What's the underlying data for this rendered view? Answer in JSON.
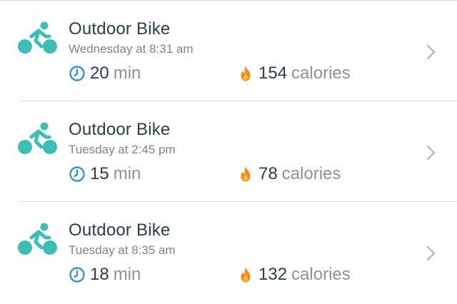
{
  "activities": [
    {
      "icon": "bike-icon",
      "title": "Outdoor Bike",
      "when": "Wednesday at 8:31 am",
      "duration_value": "20",
      "duration_unit": "min",
      "calories_value": "154",
      "calories_unit": "calories"
    },
    {
      "icon": "bike-icon",
      "title": "Outdoor Bike",
      "when": "Tuesday at 2:45 pm",
      "duration_value": "15",
      "duration_unit": "min",
      "calories_value": "78",
      "calories_unit": "calories"
    },
    {
      "icon": "bike-icon",
      "title": "Outdoor Bike",
      "when": "Tuesday at 8:35 am",
      "duration_value": "18",
      "duration_unit": "min",
      "calories_value": "132",
      "calories_unit": "calories"
    }
  ],
  "colors": {
    "bike_icon": "#3dbdb6",
    "clock_icon": "#3b8fd9",
    "flame_outer": "#f58a1f",
    "flame_inner": "#ffc233",
    "title_text": "#2a3e48",
    "secondary_text": "#7b858b",
    "divider": "#d9d9d9",
    "chevron": "#b3b8bb"
  }
}
